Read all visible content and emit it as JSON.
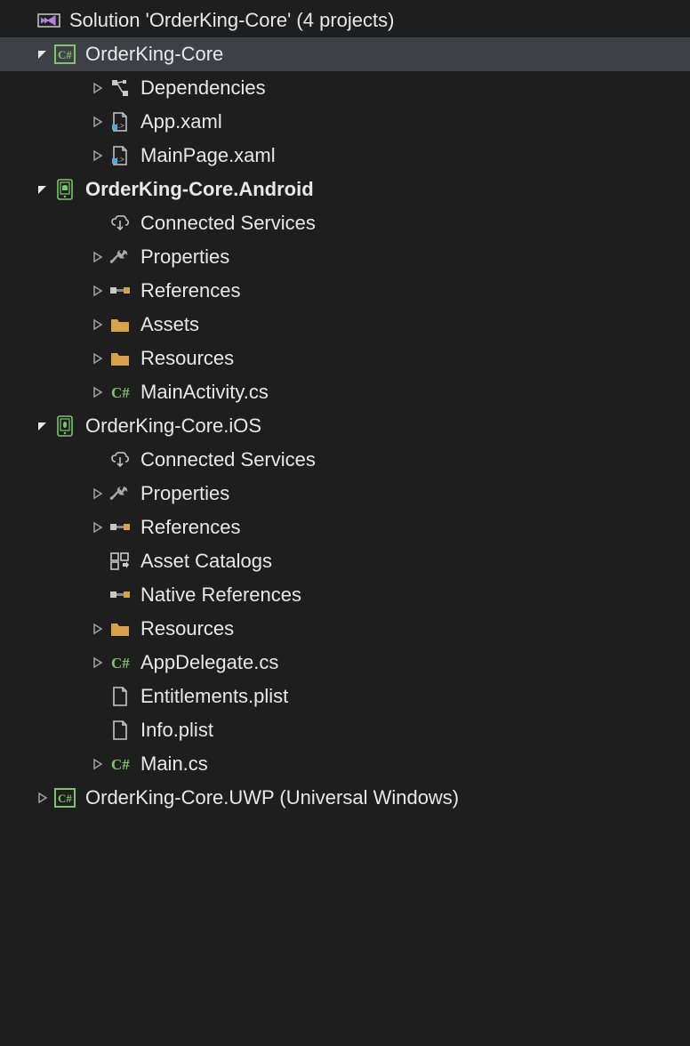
{
  "solution": {
    "label": "Solution 'OrderKing-Core' (4 projects)"
  },
  "projects": {
    "core": {
      "label": "OrderKing-Core",
      "deps": "Dependencies",
      "app_xaml": "App.xaml",
      "mainpage_xaml": "MainPage.xaml"
    },
    "android": {
      "label": "OrderKing-Core.Android",
      "connected": "Connected Services",
      "properties": "Properties",
      "references": "References",
      "assets": "Assets",
      "resources": "Resources",
      "mainactivity": "MainActivity.cs"
    },
    "ios": {
      "label": "OrderKing-Core.iOS",
      "connected": "Connected Services",
      "properties": "Properties",
      "references": "References",
      "asset_catalogs": "Asset Catalogs",
      "native_refs": "Native References",
      "resources": "Resources",
      "appdelegate": "AppDelegate.cs",
      "entitlements": "Entitlements.plist",
      "info": "Info.plist",
      "main": "Main.cs"
    },
    "uwp": {
      "label": "OrderKing-Core.UWP (Universal Windows)"
    }
  }
}
